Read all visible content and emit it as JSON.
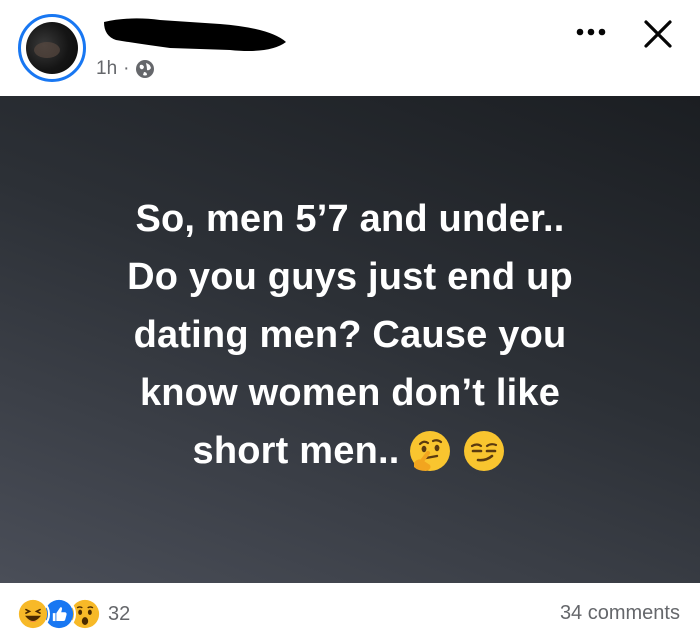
{
  "header": {
    "time": "1h",
    "separator": "·",
    "privacy_icon": "globe-icon",
    "more_icon": "more-horizontal-icon",
    "close_icon": "close-icon"
  },
  "post": {
    "lines": [
      "So, men 5’7 and under..",
      "Do you guys just end up",
      "dating men? Cause you",
      "know women don’t like",
      "short men.."
    ],
    "emojis": [
      "thinking-face-emoji",
      "smirking-face-emoji"
    ]
  },
  "footer": {
    "reactions": [
      "haha-reaction-icon",
      "like-reaction-icon",
      "wow-reaction-icon"
    ],
    "reaction_count": "32",
    "comments": "34 comments"
  },
  "colors": {
    "accent": "#1877f2",
    "muted_text": "#65676b",
    "background_dark": "#1b1e22",
    "background_light": "#4a4e58"
  }
}
